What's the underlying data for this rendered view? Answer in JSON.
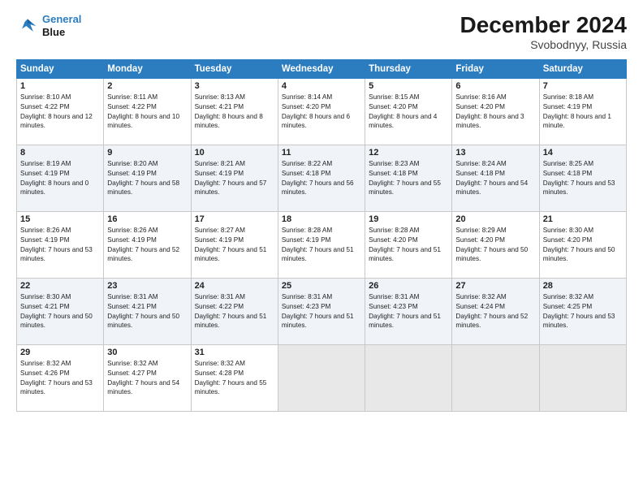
{
  "header": {
    "logo_line1": "General",
    "logo_line2": "Blue",
    "month": "December 2024",
    "location": "Svobodnyy, Russia"
  },
  "days_of_week": [
    "Sunday",
    "Monday",
    "Tuesday",
    "Wednesday",
    "Thursday",
    "Friday",
    "Saturday"
  ],
  "weeks": [
    [
      {
        "day": "1",
        "sunrise": "8:10 AM",
        "sunset": "4:22 PM",
        "daylight": "8 hours and 12 minutes."
      },
      {
        "day": "2",
        "sunrise": "8:11 AM",
        "sunset": "4:22 PM",
        "daylight": "8 hours and 10 minutes."
      },
      {
        "day": "3",
        "sunrise": "8:13 AM",
        "sunset": "4:21 PM",
        "daylight": "8 hours and 8 minutes."
      },
      {
        "day": "4",
        "sunrise": "8:14 AM",
        "sunset": "4:20 PM",
        "daylight": "8 hours and 6 minutes."
      },
      {
        "day": "5",
        "sunrise": "8:15 AM",
        "sunset": "4:20 PM",
        "daylight": "8 hours and 4 minutes."
      },
      {
        "day": "6",
        "sunrise": "8:16 AM",
        "sunset": "4:20 PM",
        "daylight": "8 hours and 3 minutes."
      },
      {
        "day": "7",
        "sunrise": "8:18 AM",
        "sunset": "4:19 PM",
        "daylight": "8 hours and 1 minute."
      }
    ],
    [
      {
        "day": "8",
        "sunrise": "8:19 AM",
        "sunset": "4:19 PM",
        "daylight": "8 hours and 0 minutes."
      },
      {
        "day": "9",
        "sunrise": "8:20 AM",
        "sunset": "4:19 PM",
        "daylight": "7 hours and 58 minutes."
      },
      {
        "day": "10",
        "sunrise": "8:21 AM",
        "sunset": "4:19 PM",
        "daylight": "7 hours and 57 minutes."
      },
      {
        "day": "11",
        "sunrise": "8:22 AM",
        "sunset": "4:18 PM",
        "daylight": "7 hours and 56 minutes."
      },
      {
        "day": "12",
        "sunrise": "8:23 AM",
        "sunset": "4:18 PM",
        "daylight": "7 hours and 55 minutes."
      },
      {
        "day": "13",
        "sunrise": "8:24 AM",
        "sunset": "4:18 PM",
        "daylight": "7 hours and 54 minutes."
      },
      {
        "day": "14",
        "sunrise": "8:25 AM",
        "sunset": "4:18 PM",
        "daylight": "7 hours and 53 minutes."
      }
    ],
    [
      {
        "day": "15",
        "sunrise": "8:26 AM",
        "sunset": "4:19 PM",
        "daylight": "7 hours and 53 minutes."
      },
      {
        "day": "16",
        "sunrise": "8:26 AM",
        "sunset": "4:19 PM",
        "daylight": "7 hours and 52 minutes."
      },
      {
        "day": "17",
        "sunrise": "8:27 AM",
        "sunset": "4:19 PM",
        "daylight": "7 hours and 51 minutes."
      },
      {
        "day": "18",
        "sunrise": "8:28 AM",
        "sunset": "4:19 PM",
        "daylight": "7 hours and 51 minutes."
      },
      {
        "day": "19",
        "sunrise": "8:28 AM",
        "sunset": "4:20 PM",
        "daylight": "7 hours and 51 minutes."
      },
      {
        "day": "20",
        "sunrise": "8:29 AM",
        "sunset": "4:20 PM",
        "daylight": "7 hours and 50 minutes."
      },
      {
        "day": "21",
        "sunrise": "8:30 AM",
        "sunset": "4:20 PM",
        "daylight": "7 hours and 50 minutes."
      }
    ],
    [
      {
        "day": "22",
        "sunrise": "8:30 AM",
        "sunset": "4:21 PM",
        "daylight": "7 hours and 50 minutes."
      },
      {
        "day": "23",
        "sunrise": "8:31 AM",
        "sunset": "4:21 PM",
        "daylight": "7 hours and 50 minutes."
      },
      {
        "day": "24",
        "sunrise": "8:31 AM",
        "sunset": "4:22 PM",
        "daylight": "7 hours and 51 minutes."
      },
      {
        "day": "25",
        "sunrise": "8:31 AM",
        "sunset": "4:23 PM",
        "daylight": "7 hours and 51 minutes."
      },
      {
        "day": "26",
        "sunrise": "8:31 AM",
        "sunset": "4:23 PM",
        "daylight": "7 hours and 51 minutes."
      },
      {
        "day": "27",
        "sunrise": "8:32 AM",
        "sunset": "4:24 PM",
        "daylight": "7 hours and 52 minutes."
      },
      {
        "day": "28",
        "sunrise": "8:32 AM",
        "sunset": "4:25 PM",
        "daylight": "7 hours and 53 minutes."
      }
    ],
    [
      {
        "day": "29",
        "sunrise": "8:32 AM",
        "sunset": "4:26 PM",
        "daylight": "7 hours and 53 minutes."
      },
      {
        "day": "30",
        "sunrise": "8:32 AM",
        "sunset": "4:27 PM",
        "daylight": "7 hours and 54 minutes."
      },
      {
        "day": "31",
        "sunrise": "8:32 AM",
        "sunset": "4:28 PM",
        "daylight": "7 hours and 55 minutes."
      },
      null,
      null,
      null,
      null
    ]
  ]
}
